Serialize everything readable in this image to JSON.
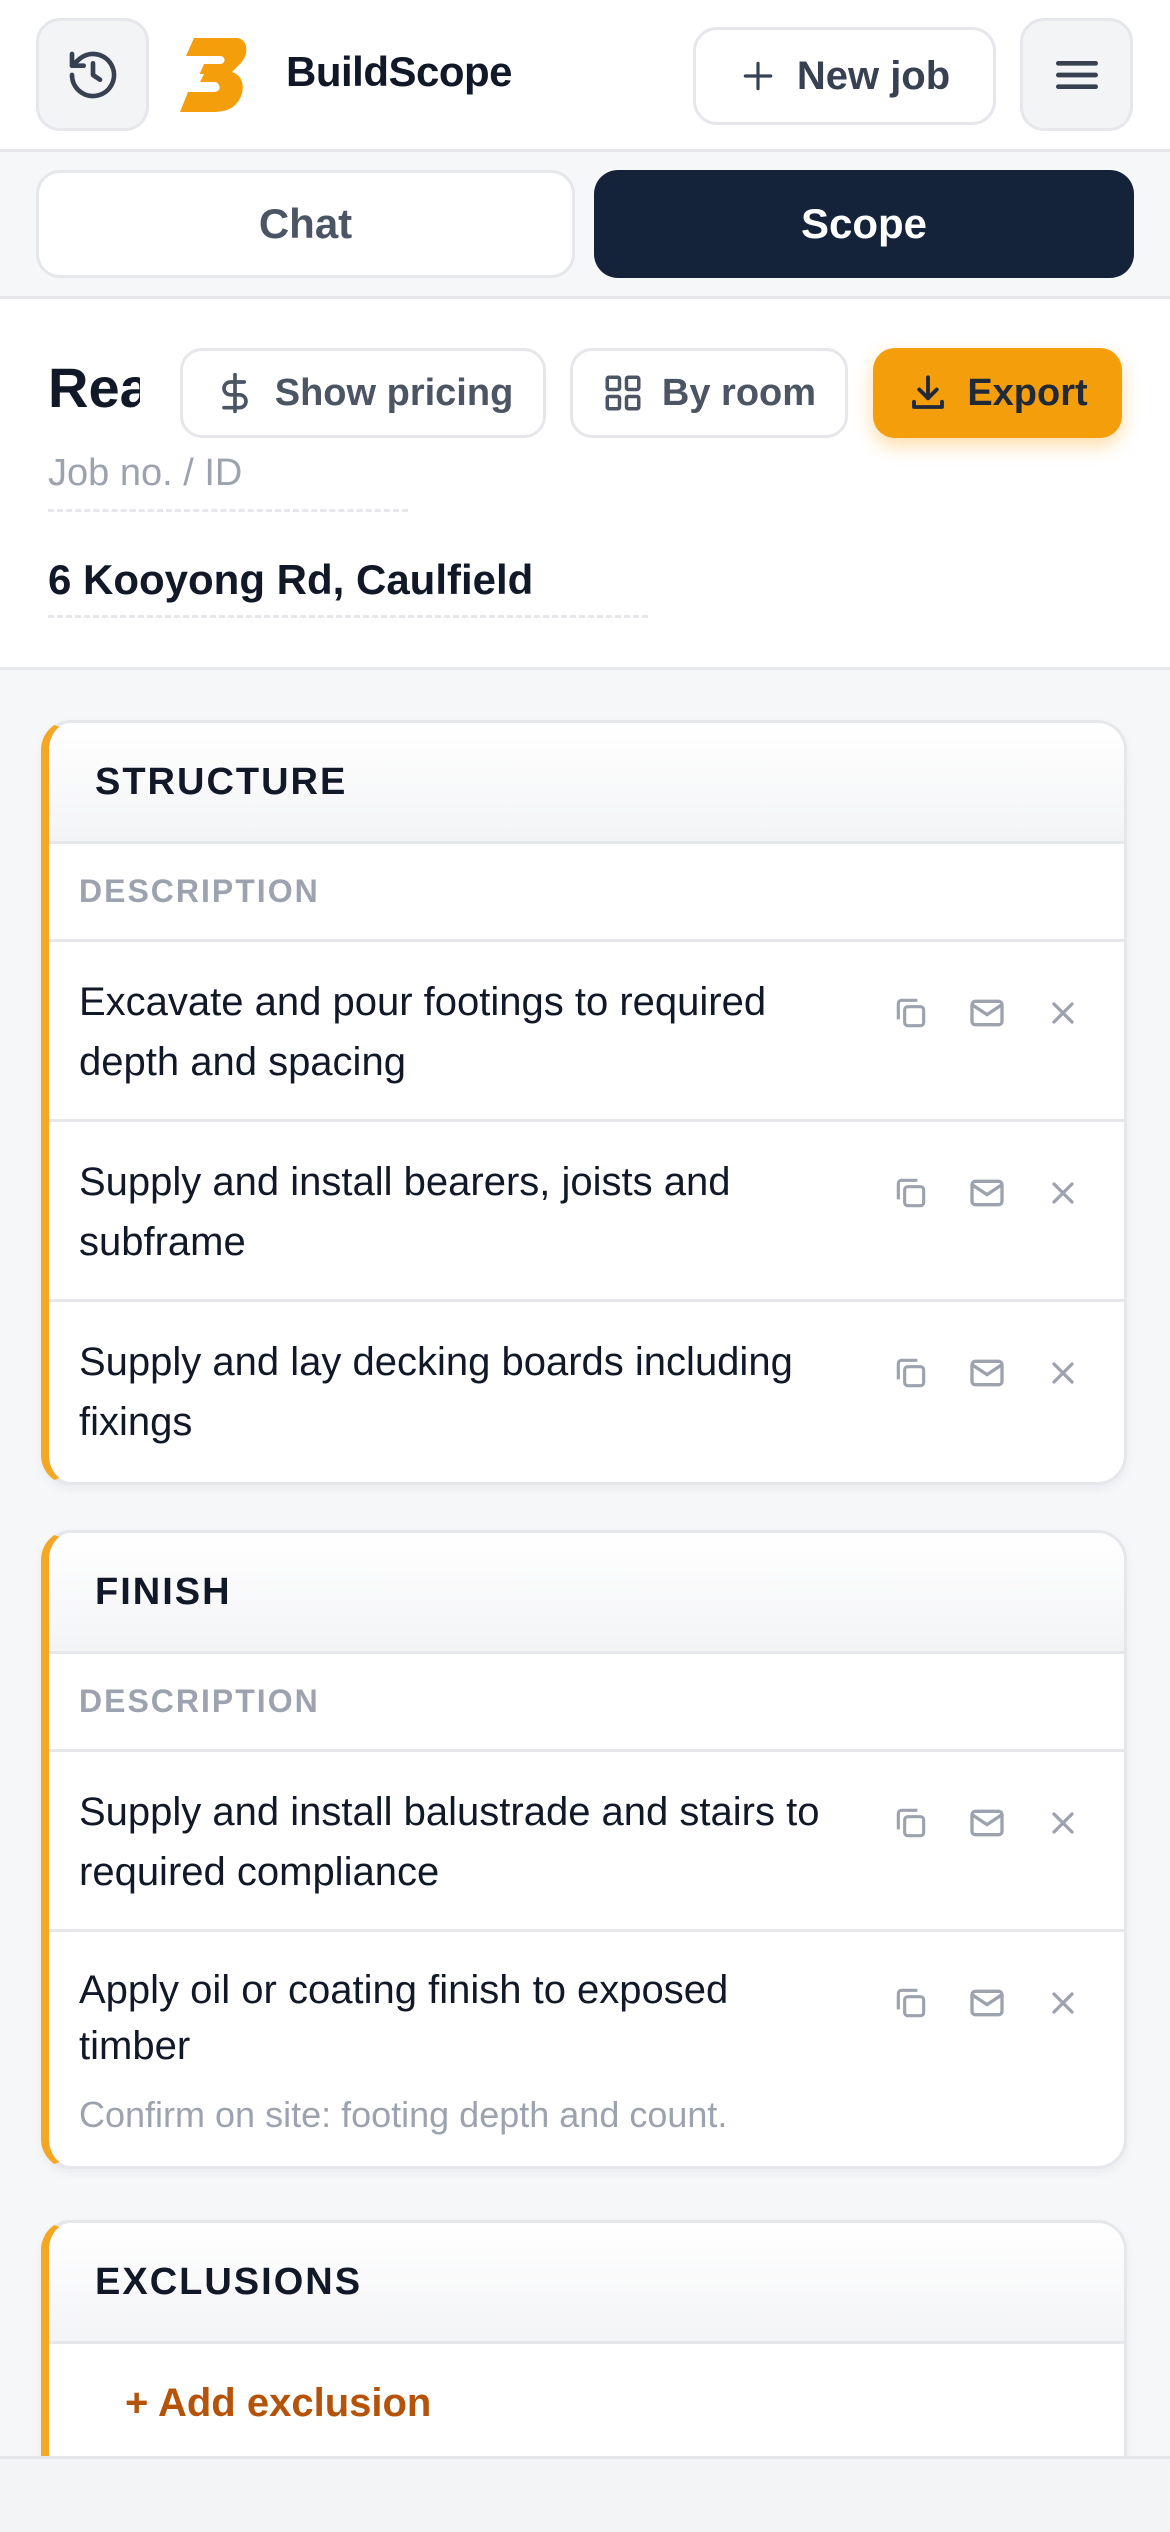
{
  "app": {
    "brand": "BuildScope",
    "new_job_label": "New job"
  },
  "tabs": [
    {
      "label": "Chat"
    },
    {
      "label": "Scope"
    }
  ],
  "job": {
    "title": "Rea",
    "job_no_placeholder": "Job no. / ID",
    "address": "6 Kooyong Rd, Caulfield"
  },
  "toolbar": {
    "pricing_label": "Show pricing",
    "room_label": "By room",
    "export_label": "Export"
  },
  "colors": {
    "accent": "#f5a623",
    "primary_dark": "#15233a",
    "export_bg": "#f59e0b",
    "link": "#b45309"
  },
  "sections": [
    {
      "title": "STRUCTURE",
      "column": "DESCRIPTION",
      "items": [
        {
          "text": "Excavate and pour footings to required depth and spacing"
        },
        {
          "text": "Supply and install bearers, joists and subframe"
        },
        {
          "text": "Supply and lay decking boards including fixings"
        }
      ]
    },
    {
      "title": "FINISH",
      "column": "DESCRIPTION",
      "items": [
        {
          "text": "Supply and install balustrade and stairs to required compliance"
        },
        {
          "text": "Apply oil or coating finish to exposed timber",
          "note": "Confirm on site: footing depth and count."
        }
      ]
    },
    {
      "title": "EXCLUSIONS",
      "add_label": "+ Add exclusion"
    }
  ],
  "row_icons": [
    "copy-icon",
    "mail-icon",
    "close-icon"
  ]
}
